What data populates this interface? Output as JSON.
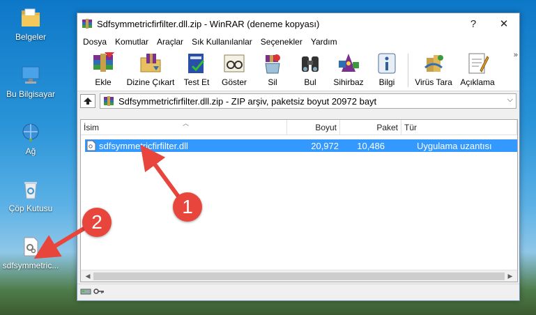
{
  "desktop": {
    "icons": [
      {
        "label": "Belgeler",
        "icon": "folder-documents-icon"
      },
      {
        "label": "Bu Bilgisayar",
        "icon": "computer-icon"
      },
      {
        "label": "Ağ",
        "icon": "network-icon"
      },
      {
        "label": "Çöp Kutusu",
        "icon": "recycle-bin-icon"
      },
      {
        "label": "sdfsymmetric...",
        "icon": "dll-file-icon"
      }
    ]
  },
  "window": {
    "title": "Sdfsymmetricfirfilter.dll.zip - WinRAR (deneme kopyası)",
    "help_label": "?",
    "close_label": "✕"
  },
  "menu": [
    "Dosya",
    "Komutlar",
    "Araçlar",
    "Sık Kullanılanlar",
    "Seçenekler",
    "Yardım"
  ],
  "toolbar": {
    "items": [
      {
        "label": "Ekle",
        "icon": "add-archive-icon"
      },
      {
        "label": "Dizine Çıkart",
        "icon": "extract-to-icon"
      },
      {
        "label": "Test Et",
        "icon": "test-icon"
      },
      {
        "label": "Göster",
        "icon": "view-icon"
      },
      {
        "label": "Sil",
        "icon": "delete-icon"
      },
      {
        "label": "Bul",
        "icon": "find-icon"
      },
      {
        "label": "Sihirbaz",
        "icon": "wizard-icon"
      },
      {
        "label": "Bilgi",
        "icon": "info-icon"
      },
      {
        "label": "Virüs Tara",
        "icon": "virus-scan-icon"
      },
      {
        "label": "Açıklama",
        "icon": "comment-icon"
      }
    ],
    "more_label": "»"
  },
  "pathbar": {
    "text": "Sdfsymmetricfirfilter.dll.zip - ZIP arşiv, paketsiz boyut 20972 bayt",
    "dropdown": "⌵"
  },
  "list": {
    "columns": [
      "İsim",
      "Boyut",
      "Paket",
      "Tür"
    ],
    "rows": [
      {
        "name": "sdfsymmetricfirfilter.dll",
        "size": "20,972",
        "packed": "10,486",
        "type": "Uygulama uzantısı"
      }
    ]
  },
  "annotations": [
    "1",
    "2"
  ],
  "colors": {
    "selection": "#3399ff",
    "annotation": "#e8453c"
  }
}
